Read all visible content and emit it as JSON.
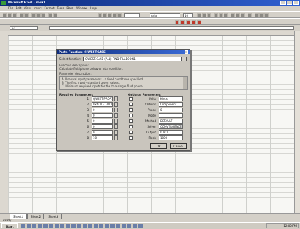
{
  "window": {
    "title": "Microsoft Excel - Book1"
  },
  "menu": [
    "File",
    "Edit",
    "View",
    "Insert",
    "Format",
    "Tools",
    "Data",
    "Window",
    "Help"
  ],
  "toolbar": {
    "font_name": "Arial",
    "font_size": "10"
  },
  "formula_bar": {
    "cell_ref": "A1"
  },
  "dialog": {
    "title": "Paste Function: fHWEST.CASE",
    "function_label": "Select function:",
    "function_value": "QWEST.CASE (ALL) FIND FILLBOOK1",
    "description_label": "Function description:",
    "description_sub": "Calculate fluid phase behavior at a condition.",
    "parameter_desc_label": "Parameter description:",
    "param_lines": [
      "A. Use real input parameters - a fixed conditions specified.",
      "B. The first input - standard given values.",
      "C. Minimum required inputs for the to a single fluid phase."
    ],
    "required_label": "Required Parameters",
    "optional_label": "Optional Parameters",
    "required": [
      {
        "label": "1",
        "value": "QWEST.PROP1_FILE"
      },
      {
        "label": "2",
        "value": "0x4C0 F FLN1"
      },
      {
        "label": "3",
        "value": "0"
      },
      {
        "label": "4",
        "value": "0"
      },
      {
        "label": "5",
        "value": "0"
      },
      {
        "label": "6",
        "value": "0"
      },
      {
        "label": "7",
        "value": "0"
      },
      {
        "label": "8",
        "value": "10"
      }
    ],
    "optional": [
      {
        "name": "Units",
        "value": "Kinds"
      },
      {
        "name": "Options",
        "value": "Component"
      },
      {
        "name": "Phase",
        "value": "0"
      },
      {
        "name": "Mode",
        "value": ""
      },
      {
        "name": "Method",
        "value": "DEFAULT"
      },
      {
        "name": "Solver",
        "value": "CONVERGENCE"
      },
      {
        "name": "Output",
        "value": "0.001"
      },
      {
        "name": "Flash",
        "value": "1000"
      }
    ],
    "ok_label": "OK",
    "cancel_label": "Cancel"
  },
  "sheet_tabs": [
    "Sheet1",
    "Sheet2",
    "Sheet3"
  ],
  "status": {
    "text": "Ready"
  },
  "taskbar": {
    "start_label": "Start",
    "clock": "12:00 PM"
  },
  "colors": {
    "title_start": "#0d2a7a",
    "title_end": "#2f5fd0",
    "chrome": "#d4d0c8",
    "grid": "#f7f7f4"
  }
}
